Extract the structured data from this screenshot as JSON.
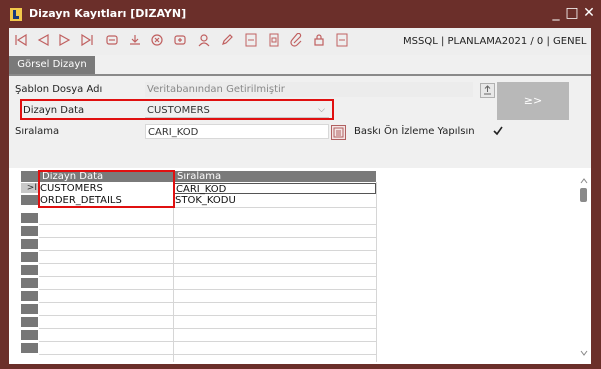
{
  "window": {
    "title": "Dizayn Kayıtları [DIZAYN]",
    "min_symbol": "_",
    "max_symbol": "□",
    "close_symbol": "✕"
  },
  "toolbar": {
    "buttons": [
      {
        "name": "first-record-icon"
      },
      {
        "name": "prev-record-icon"
      },
      {
        "name": "next-record-icon"
      },
      {
        "name": "last-record-icon"
      },
      {
        "name": "save-icon"
      },
      {
        "name": "download-icon"
      },
      {
        "name": "cancel-icon"
      },
      {
        "name": "new-record-icon"
      },
      {
        "name": "user-icon"
      },
      {
        "name": "edit-pencil-icon"
      },
      {
        "name": "log-icon"
      },
      {
        "name": "document-icon"
      },
      {
        "name": "attach-icon"
      },
      {
        "name": "lock-icon"
      },
      {
        "name": "xls-icon"
      }
    ],
    "connection_info": "MSSQL | PLANLAMA2021 / 0 | GENEL"
  },
  "tab": {
    "label": "Görsel Dizayn"
  },
  "form": {
    "sablon_label": "Şablon Dosya Adı",
    "sablon_value": "Veritabanından Getirilmiştir",
    "dizayn_label": "Dizayn Data",
    "dizayn_value": "CUSTOMERS",
    "siralama_label": "Sıralama",
    "siralama_value": "CARI_KOD",
    "baski_label": "Baskı Ön İzleme Yapılsın",
    "baski_checked": true,
    "go_label": "≥>"
  },
  "grid": {
    "columns": [
      "Dizayn Data",
      "Sıralama"
    ],
    "rows": [
      [
        "CUSTOMERS",
        "CARI_KOD"
      ],
      [
        "ORDER_DETAILS",
        "STOK_KODU"
      ]
    ],
    "current_row_marker": ">I"
  },
  "colors": {
    "title_bar": "#6b2f2a",
    "highlight_box": "#e01010",
    "header": "#7a7a7a"
  }
}
